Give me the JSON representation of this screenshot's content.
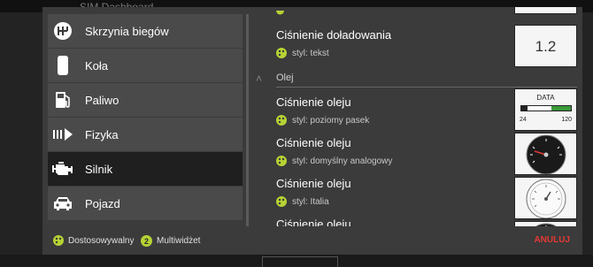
{
  "background": {
    "title": "SIM Dashboard"
  },
  "categories": [
    {
      "label": "Skrzynia biegów",
      "icon": "gearbox-icon",
      "selected": false
    },
    {
      "label": "Koła",
      "icon": "wheel-icon",
      "selected": false
    },
    {
      "label": "Paliwo",
      "icon": "fuel-icon",
      "selected": false
    },
    {
      "label": "Fizyka",
      "icon": "physics-icon",
      "selected": false
    },
    {
      "label": "Silnik",
      "icon": "engine-icon",
      "selected": true
    },
    {
      "label": "Pojazd",
      "icon": "car-icon",
      "selected": false
    }
  ],
  "widgets": {
    "boost": {
      "title": "Ciśnienie doładowania",
      "style": "styl: tekst",
      "thumb_value": "1.2"
    },
    "group": {
      "label": "Olej"
    },
    "oil_bar": {
      "title": "Ciśnienie oleju",
      "style": "styl: poziomy pasek",
      "thumb_title": "DATA",
      "thumb_min": "24",
      "thumb_max": "120"
    },
    "oil_analog": {
      "title": "Ciśnienie oleju",
      "style": "styl: domyślny analogowy"
    },
    "oil_italia": {
      "title": "Ciśnienie oleju",
      "style": "styl: Italia"
    },
    "oil_more": {
      "title": "Ciśnienie oleju"
    }
  },
  "footer": {
    "legend_custom": "Dostosowywalny",
    "legend_multi_badge": "2",
    "legend_multi": "Multiwidżet",
    "cancel": "ANULUJ"
  },
  "colors": {
    "accent": "#b5d334",
    "cancel": "#e53935",
    "selected": "#1f1f1f"
  }
}
